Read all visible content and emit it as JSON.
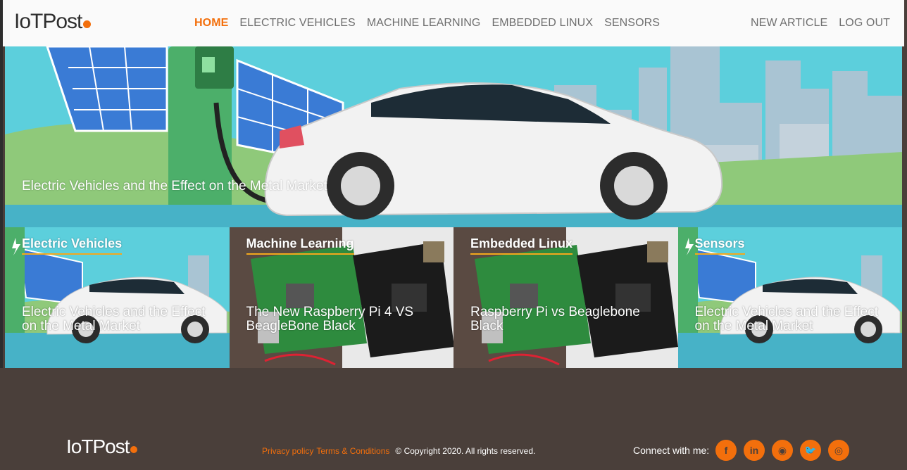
{
  "brand": {
    "name": "IoTPost"
  },
  "nav": {
    "items": [
      {
        "label": "HOME",
        "active": true
      },
      {
        "label": "ELECTRIC VEHICLES"
      },
      {
        "label": "MACHINE LEARNING"
      },
      {
        "label": "EMBEDDED LINUX"
      },
      {
        "label": "SENSORS"
      }
    ],
    "new_article": "NEW ARTICLE",
    "logout": "LOG OUT"
  },
  "hero": {
    "title": "Electric Vehicles and the Effect on the Metal Market"
  },
  "cards": [
    {
      "category": "Electric Vehicles",
      "title": "Electric Vehicles and the Effect on the Metal Market",
      "image": "ev-charging"
    },
    {
      "category": "Machine Learning",
      "title": "The New Raspberry Pi 4 VS BeagleBone Black",
      "image": "boards"
    },
    {
      "category": "Embedded Linux",
      "title": "Raspberry Pi vs Beaglebone Black",
      "image": "boards"
    },
    {
      "category": "Sensors",
      "title": "Electric Vehicles and the Effect on the Metal Market",
      "image": "ev-charging"
    }
  ],
  "footer": {
    "brand": "IoTPost",
    "privacy": "Privacy policy",
    "terms": "Terms & Conditions",
    "copyright": "© Copyright 2020. All rights reserved.",
    "connect": "Connect with me:",
    "socials": [
      {
        "name": "facebook-icon",
        "glyph": "f"
      },
      {
        "name": "linkedin-icon",
        "glyph": "in"
      },
      {
        "name": "github-icon",
        "glyph": "◉"
      },
      {
        "name": "twitter-icon",
        "glyph": "🐦"
      },
      {
        "name": "instagram-icon",
        "glyph": "◎"
      }
    ]
  },
  "colors": {
    "accent": "#f36f0c",
    "underline": "#f3a81c",
    "footer_bg": "#4a3f3a",
    "nav_bg": "#fafafa"
  }
}
